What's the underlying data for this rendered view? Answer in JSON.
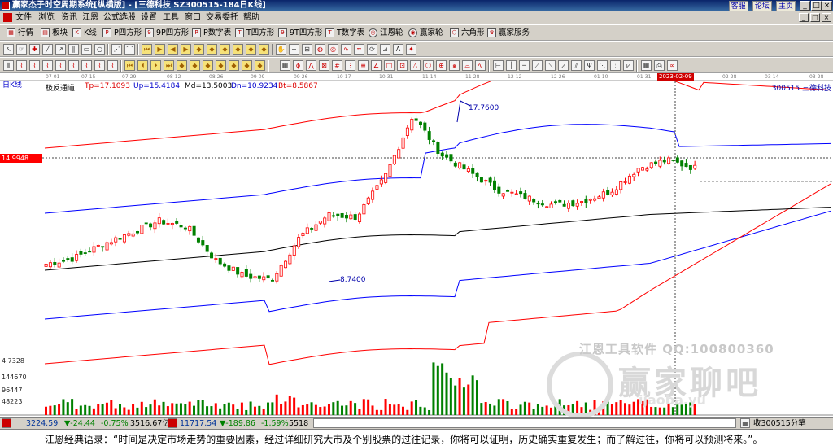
{
  "window": {
    "title": "赢家杰子时空周期系统[纵横版] - [三德科技  SZ300515-184日K线]",
    "links": [
      "客服",
      "论坛",
      "主页"
    ],
    "buttons": [
      "_",
      "□",
      "×"
    ]
  },
  "menu": {
    "items": [
      "文件",
      "浏览",
      "资讯",
      "江恩",
      "公式选股",
      "设置",
      "工具",
      "窗口",
      "交易委托",
      "帮助"
    ],
    "window_buttons": [
      "_",
      "□",
      "×"
    ]
  },
  "toolbar1": {
    "items": [
      "行情",
      "板块",
      "K线",
      "P四方形",
      "9P四方形",
      "P数字表",
      "T四方形",
      "9T四方形",
      "T数字表",
      "江恩轮",
      "赢家轮",
      "六角形",
      "赢家服务"
    ]
  },
  "chart": {
    "period_label": "日K线",
    "indicator_name": "极反通道",
    "tp": "Tp=17.1093",
    "up": "Up=15.4184",
    "md": "Md=13.5003",
    "dn": "Dn=10.9234",
    "bt": "Bt=8.5867",
    "stock": "300515  三德科技",
    "cursor_price": "14.9948",
    "high_label": "17.7600",
    "low_label": "8.7400",
    "cursor_date": "2023-02-09",
    "dates": [
      "07-01",
      "07-15",
      "07-29",
      "08-12",
      "08-26",
      "09-09",
      "09-26",
      "10-17",
      "10-31",
      "11-14",
      "11-28",
      "12-12",
      "12-26",
      "01-10",
      "01-31",
      "2023-02-09",
      "02-28",
      "03-14",
      "03-28"
    ],
    "vol_labels": [
      "4.7328",
      "144670",
      "96447",
      "48223"
    ],
    "watermark": {
      "line1": "江恩工具软件  QQ:100800360",
      "line2": "赢家聊吧",
      "line3": "ijaoba.yu"
    }
  },
  "status": {
    "sh_index": "3224.59",
    "sh_change": "▼-24.44",
    "sh_pct": "-0.75%",
    "sh_amount": "3516.67亿",
    "sz_index": "11717.54",
    "sz_change": "▼-189.86",
    "sz_pct": "-1.59%",
    "sz_amount": "5518",
    "right_text": "收300515分笔"
  },
  "quote": {
    "text": "江恩经典语录：“时间是决定市场走势的重要因素，经过详细研究大市及个别股票的过往记录，你将可以证明，历史确实重复发生；而了解过往，你将可以预测将来。”。"
  },
  "chart_data": {
    "type": "candlestick",
    "x_start": "07-01",
    "x_end": "03-28",
    "series_names": [
      "Tp",
      "Up",
      "Md",
      "Dn",
      "Bt"
    ],
    "close_approx": [
      9.6,
      9.9,
      10.6,
      11.2,
      11.8,
      11.5,
      9.8,
      9.0,
      8.8,
      11.0,
      12.1,
      12.0,
      14.0,
      17.2,
      15.2,
      14.3,
      13.4,
      13.0,
      12.6,
      12.8,
      13.3,
      14.5,
      14.9,
      14.5
    ],
    "colors": {
      "up_candle": "#ff0000",
      "down_candle": "#008000",
      "tp_bt": "#ff0000",
      "up_dn": "#0000ff",
      "md": "#000000"
    }
  }
}
